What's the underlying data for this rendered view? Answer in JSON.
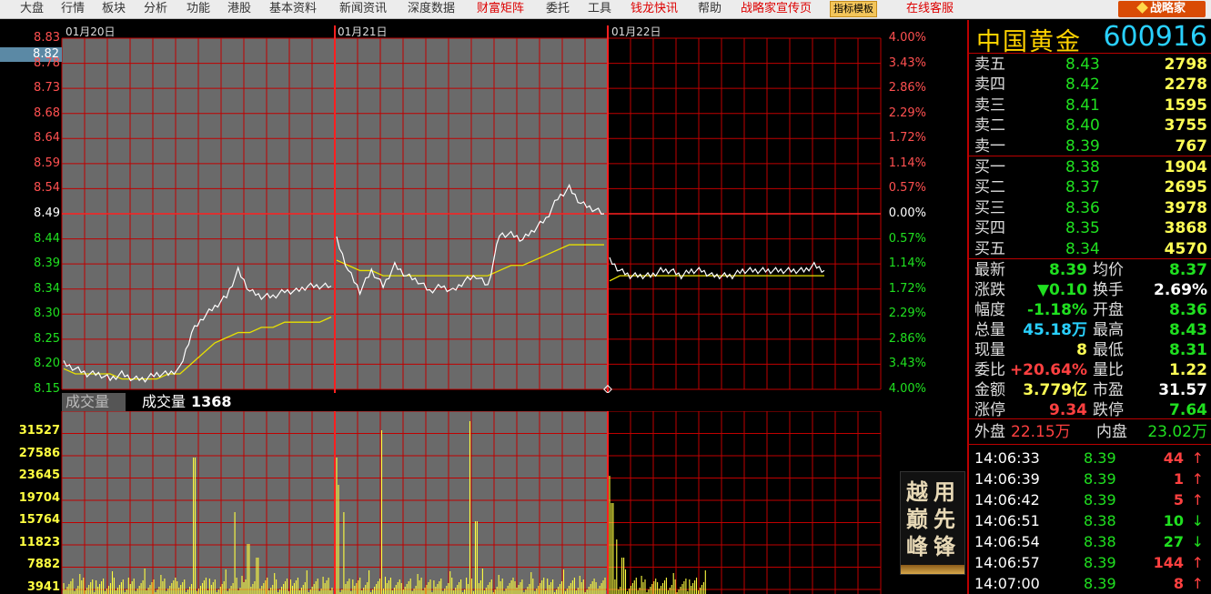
{
  "menu": {
    "items": [
      {
        "label": "大盘",
        "color": "normal"
      },
      {
        "label": "行情",
        "color": "normal"
      },
      {
        "label": "板块",
        "color": "normal"
      },
      {
        "label": "分析",
        "color": "normal"
      },
      {
        "label": "功能",
        "color": "normal"
      },
      {
        "label": "港股",
        "color": "normal"
      },
      {
        "label": "基本资料",
        "color": "normal"
      },
      {
        "label": "新闻资讯",
        "color": "normal"
      },
      {
        "label": "深度数据",
        "color": "normal"
      },
      {
        "label": "财富矩阵",
        "color": "red"
      },
      {
        "label": "委托",
        "color": "normal"
      },
      {
        "label": "工具",
        "color": "normal"
      },
      {
        "label": "钱龙快讯",
        "color": "red"
      },
      {
        "label": "帮助",
        "color": "normal"
      },
      {
        "label": "战略家宣传页",
        "color": "red"
      },
      {
        "label": "指标模板",
        "color": "badge"
      },
      {
        "label": "在线客服",
        "color": "red"
      }
    ],
    "logo_text": "战略家"
  },
  "chart": {
    "dates": [
      "01月20日",
      "01月21日",
      "01月22日"
    ],
    "current_price_label": "8.82",
    "price_ticks": [
      "8.83",
      "8.78",
      "8.73",
      "8.68",
      "8.64",
      "8.59",
      "8.54",
      "8.49",
      "8.44",
      "8.39",
      "8.34",
      "8.30",
      "8.25",
      "8.20",
      "8.15"
    ],
    "pct_ticks": [
      "4.00%",
      "3.43%",
      "2.86%",
      "2.29%",
      "1.72%",
      "1.14%",
      "0.57%",
      "0.00%",
      "0.57%",
      "1.14%",
      "1.72%",
      "2.29%",
      "2.86%",
      "3.43%",
      "4.00%"
    ],
    "volume_label": "成交量",
    "volume_info_label": "成交量",
    "volume_value": "1368",
    "volume_ticks": [
      "31527",
      "27586",
      "23645",
      "19704",
      "15764",
      "11823",
      "7882",
      "3941"
    ]
  },
  "chart_data": {
    "type": "line",
    "title": "",
    "days": [
      "01月20日",
      "01月21日",
      "01月22日"
    ],
    "reference_price": 8.49,
    "ylim": [
      8.15,
      8.83
    ],
    "series": [
      {
        "day": "01月20日",
        "price": [
          8.2,
          8.19,
          8.18,
          8.18,
          8.17,
          8.18,
          8.17,
          8.17,
          8.18,
          8.18,
          8.19,
          8.26,
          8.29,
          8.31,
          8.33,
          8.38,
          8.34,
          8.33,
          8.33,
          8.34,
          8.34,
          8.35,
          8.35,
          8.35
        ],
        "avg": [
          8.19,
          8.18,
          8.18,
          8.18,
          8.18,
          8.17,
          8.17,
          8.17,
          8.17,
          8.18,
          8.18,
          8.2,
          8.22,
          8.24,
          8.25,
          8.26,
          8.26,
          8.27,
          8.27,
          8.28,
          8.28,
          8.28,
          8.28,
          8.29
        ]
      },
      {
        "day": "01月21日",
        "price": [
          8.44,
          8.38,
          8.34,
          8.38,
          8.35,
          8.39,
          8.37,
          8.36,
          8.34,
          8.35,
          8.34,
          8.36,
          8.37,
          8.35,
          8.45,
          8.45,
          8.44,
          8.46,
          8.48,
          8.52,
          8.54,
          8.51,
          8.5,
          8.49
        ],
        "avg": [
          8.4,
          8.39,
          8.38,
          8.38,
          8.37,
          8.37,
          8.37,
          8.37,
          8.37,
          8.37,
          8.37,
          8.37,
          8.37,
          8.37,
          8.38,
          8.39,
          8.39,
          8.4,
          8.41,
          8.42,
          8.43,
          8.43,
          8.43,
          8.43
        ]
      },
      {
        "day": "01月22日",
        "price": [
          8.4,
          8.38,
          8.37,
          8.37,
          8.37,
          8.38,
          8.38,
          8.37,
          8.38,
          8.38,
          8.37,
          8.37,
          8.37,
          8.38,
          8.38,
          8.38,
          8.38,
          8.38,
          8.38,
          8.38,
          8.39,
          8.38
        ],
        "avg": [
          8.36,
          8.37,
          8.37,
          8.37,
          8.37,
          8.37,
          8.37,
          8.37,
          8.37,
          8.37,
          8.37,
          8.37,
          8.37,
          8.37,
          8.37,
          8.37,
          8.37,
          8.37,
          8.37,
          8.37,
          8.37,
          8.37
        ]
      }
    ],
    "volume_ylim": [
      0,
      31527
    ]
  },
  "panel": {
    "name": "中国黄金",
    "code": "600916",
    "asks": [
      {
        "label": "卖五",
        "price": "8.43",
        "vol": "2798"
      },
      {
        "label": "卖四",
        "price": "8.42",
        "vol": "2278"
      },
      {
        "label": "卖三",
        "price": "8.41",
        "vol": "1595"
      },
      {
        "label": "卖二",
        "price": "8.40",
        "vol": "3755"
      },
      {
        "label": "卖一",
        "price": "8.39",
        "vol": "767"
      }
    ],
    "bids": [
      {
        "label": "买一",
        "price": "8.38",
        "vol": "1904"
      },
      {
        "label": "买二",
        "price": "8.37",
        "vol": "2695"
      },
      {
        "label": "买三",
        "price": "8.36",
        "vol": "3978"
      },
      {
        "label": "买四",
        "price": "8.35",
        "vol": "3868"
      },
      {
        "label": "买五",
        "price": "8.34",
        "vol": "4570"
      }
    ],
    "quote": [
      {
        "l1": "最新",
        "v1": "8.39",
        "c1": "green",
        "l2": "均价",
        "v2": "8.37",
        "c2": "green"
      },
      {
        "l1": "涨跌",
        "v1": "▼0.10",
        "c1": "green",
        "l2": "换手",
        "v2": "2.69%",
        "c2": "white"
      },
      {
        "l1": "幅度",
        "v1": "-1.18%",
        "c1": "green",
        "l2": "开盘",
        "v2": "8.36",
        "c2": "green"
      },
      {
        "l1": "总量",
        "v1": "45.18万",
        "c1": "cyan",
        "l2": "最高",
        "v2": "8.43",
        "c2": "green"
      },
      {
        "l1": "现量",
        "v1": "8",
        "c1": "yellow",
        "l2": "最低",
        "v2": "8.31",
        "c2": "green"
      },
      {
        "l1": "委比",
        "v1": "+20.64%",
        "c1": "red",
        "l2": "量比",
        "v2": "1.22",
        "c2": "yellow"
      },
      {
        "l1": "金额",
        "v1": "3.779亿",
        "c1": "yellow",
        "l2": "市盈",
        "v2": "31.57",
        "c2": "white"
      },
      {
        "l1": "涨停",
        "v1": "9.34",
        "c1": "red",
        "l2": "跌停",
        "v2": "7.64",
        "c2": "green"
      }
    ],
    "outer_label": "外盘",
    "outer_val": "22.15万",
    "inner_label": "内盘",
    "inner_val": "23.02万",
    "ticks": [
      {
        "time": "14:06:33",
        "price": "8.39",
        "qty": "44",
        "dir": "up"
      },
      {
        "time": "14:06:39",
        "price": "8.39",
        "qty": "1",
        "dir": "up"
      },
      {
        "time": "14:06:42",
        "price": "8.39",
        "qty": "5",
        "dir": "up"
      },
      {
        "time": "14:06:51",
        "price": "8.38",
        "qty": "10",
        "dir": "down"
      },
      {
        "time": "14:06:54",
        "price": "8.38",
        "qty": "27",
        "dir": "down"
      },
      {
        "time": "14:06:57",
        "price": "8.39",
        "qty": "144",
        "dir": "up"
      },
      {
        "time": "14:07:00",
        "price": "8.39",
        "qty": "8",
        "dir": "up"
      }
    ]
  },
  "ad": {
    "chars": [
      "越",
      "用",
      "巅",
      "先",
      "峰",
      "锋"
    ]
  },
  "colors": {
    "grid": "#c00000",
    "day_bg": "#6a6a6a",
    "price": "#ffffff",
    "avg": "#e8e000",
    "volume": "#ffff40"
  }
}
